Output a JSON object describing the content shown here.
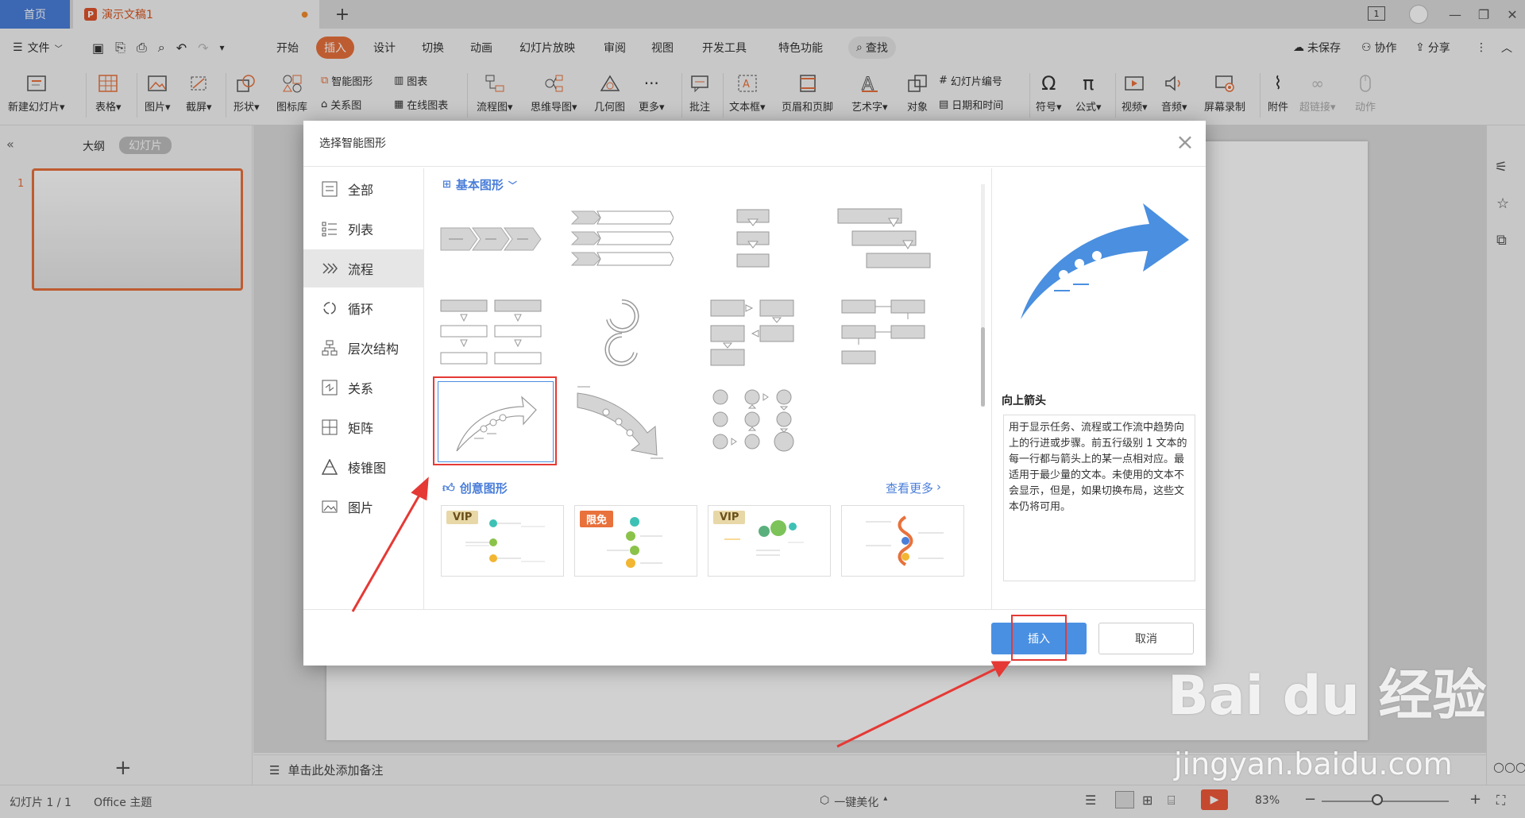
{
  "titlebar": {
    "home_tab": "首页",
    "doc_tab": "演示文稿1",
    "new_tab": "+",
    "page_badge": "1"
  },
  "menu": {
    "file": "文件",
    "items": [
      "开始",
      "插入",
      "设计",
      "切换",
      "动画",
      "幻灯片放映",
      "审阅",
      "视图",
      "开发工具",
      "特色功能"
    ],
    "search": "查找",
    "unsaved": "未保存",
    "collab": "协作",
    "share": "分享"
  },
  "ribbon": {
    "new_slide": "新建幻灯片",
    "table": "表格",
    "picture": "图片",
    "screenshot": "截屏",
    "shape": "形状",
    "icon_lib": "图标库",
    "smart_shape": "智能图形",
    "chart": "图表",
    "relation": "关系图",
    "online_chart": "在线图表",
    "flowchart": "流程图",
    "mindmap": "思维导图",
    "geometry": "几何图",
    "more": "更多",
    "comment": "批注",
    "textbox": "文本框",
    "header_footer": "页眉和页脚",
    "art_text": "艺术字",
    "object": "对象",
    "slide_number": "幻灯片编号",
    "datetime": "日期和时间",
    "symbol": "符号",
    "formula": "公式",
    "video": "视频",
    "audio": "音频",
    "screen_record": "屏幕录制",
    "attachment": "附件",
    "hyperlink": "超链接",
    "action": "动作"
  },
  "leftpanel": {
    "outline_tab": "大纲",
    "slides_tab": "幻灯片",
    "slide_index": "1",
    "add": "+"
  },
  "notes": {
    "placeholder": "单击此处添加备注"
  },
  "status": {
    "slide_count": "幻灯片 1 / 1",
    "theme": "Office 主题",
    "beautify": "一键美化",
    "zoom": "83%"
  },
  "dialog": {
    "title": "选择智能图形",
    "categories": [
      "全部",
      "列表",
      "流程",
      "循环",
      "层次结构",
      "关系",
      "矩阵",
      "棱锥图",
      "图片"
    ],
    "section_basic": "基本图形",
    "section_creative": "创意图形",
    "see_more": "查看更多",
    "badges": [
      "VIP",
      "限免",
      "VIP"
    ],
    "preview_name": "向上箭头",
    "preview_desc": "用于显示任务、流程或工作流中趋势向上的行进或步骤。前五行级别 1 文本的每一行都与箭头上的某一点相对应。最适用于最少量的文本。未使用的文本不会显示，但是，如果切换布局，这些文本仍将可用。",
    "insert_btn": "插入",
    "cancel_btn": "取消"
  },
  "watermark": {
    "brand": "Bai du 经验",
    "url": "jingyan.baidu.com"
  },
  "colors": {
    "accent_orange": "#e8713c",
    "primary_blue": "#4a90e2",
    "highlight_red": "#e53935",
    "shape_blue": "#4a8fe0"
  }
}
